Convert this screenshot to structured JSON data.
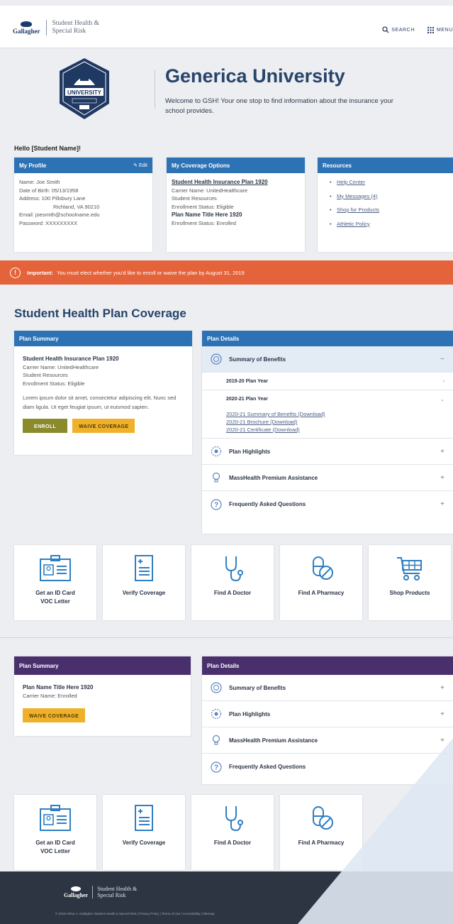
{
  "header": {
    "brand_name": "Gallagher",
    "brand_tagline_1": "Student Health &",
    "brand_tagline_2": "Special Risk",
    "search_label": "SEARCH",
    "menu_label": "MENU"
  },
  "hero": {
    "seal_text": "UNIVERSITY",
    "title": "Generica University",
    "subtitle": "Welcome to GSH! Your one stop to find information about the insurance your school provides."
  },
  "greeting": "Hello [Student Name]!",
  "profile": {
    "title": "My Profile",
    "edit_label": "Edit",
    "lines": [
      "Name: Joe Smith",
      "Date of Birth: 05/13/1958",
      "Address: 100 Pillsbury Lane",
      "Richland, VA 90210",
      "Email: joesmith@schoolname.edu",
      "Password: XXXXXXXXX"
    ]
  },
  "coverage": {
    "title": "My Coverage Options",
    "plan1_link": "Student Health Insurance Plan 1920",
    "plan1_lines": [
      "Carrier Name: UnitedHealthcare",
      "Student Resources",
      "Enrollment Status: Eligible"
    ],
    "plan2_title": "Plan Name Title Here 1920",
    "plan2_status": "Enrollment Status: Enrolled"
  },
  "resources": {
    "title": "Resources",
    "items": [
      "Help Center",
      "My Messages (4)",
      "Shop for Products",
      "Athletic Policy"
    ]
  },
  "alert": {
    "icon": "!",
    "label": "Important:",
    "text": "You must elect whether you'd like to enroll or waive the plan by August 31, 2019"
  },
  "section_title": "Student Health Plan Coverage",
  "summary1": {
    "header": "Plan Summary",
    "plan": "Student Health Insurance Plan 1920",
    "lines": [
      "Carrier Name: UnitedHealthcare",
      "Student Resources",
      "Enrollment Status: Eligible"
    ],
    "body": "Lorem ipsum dolor sit amet, consectetur adipiscing elit. Nunc sed diam ligula. Ut eget feugiat ipsum, ut euismod sapien.",
    "enroll_btn": "ENROLL",
    "waive_btn": "WAIVE COVERAGE"
  },
  "details1": {
    "header": "Plan Details",
    "summary_benefits": "Summary of Benefits",
    "year1": "2019-20 Plan Year",
    "year2": "2020-21 Plan Year",
    "links": [
      "2020-21 Summary of Benefits (Download)",
      "2020-21 Brochure (Download)",
      "2020-21 Certificate (Download)"
    ],
    "highlights": "Plan Highlights",
    "masshealth": "MassHealth Premium Assistance",
    "faq": "Frequently Asked Questions",
    "minus": "−",
    "plus": "+"
  },
  "tiles1": [
    {
      "l1": "Get an ID Card",
      "l2": "VOC Letter"
    },
    {
      "l1": "Verify Coverage",
      "l2": ""
    },
    {
      "l1": "Find A Doctor",
      "l2": ""
    },
    {
      "l1": "Find A Pharmacy",
      "l2": ""
    },
    {
      "l1": "Shop Products",
      "l2": ""
    }
  ],
  "summary2": {
    "header": "Plan Summary",
    "plan": "Plan Name Title Here 1920",
    "line": "Carrier Name: Enrolled",
    "waive_btn": "WAIVE COVERAGE"
  },
  "details2": {
    "header": "Plan Details",
    "summary_benefits": "Summary of Benefits",
    "highlights": "Plan Highlights",
    "masshealth": "MassHealth Premium Assistance",
    "faq": "Frequently Asked Questions",
    "plus": "+"
  },
  "tiles2": [
    {
      "l1": "Get an ID Card",
      "l2": "VOC Letter"
    },
    {
      "l1": "Verify Coverage",
      "l2": ""
    },
    {
      "l1": "Find A Doctor",
      "l2": ""
    },
    {
      "l1": "Find A Pharmacy",
      "l2": ""
    }
  ],
  "footer": {
    "brand_name": "Gallagher",
    "tagline_1": "Student Health &",
    "tagline_2": "Special Risk",
    "copyright": "© 2019 Arthur J. Gallagher Student Health & Special Risk | Privacy Policy | Terms of Use | Accessibility | Sitemap"
  },
  "colors": {
    "primary_blue": "#2c72b5",
    "purple": "#4a2f6d",
    "alert_orange": "#e4633a",
    "olive": "#8b8b2c",
    "yellow": "#f0b12a",
    "navy_text": "#27446b"
  }
}
